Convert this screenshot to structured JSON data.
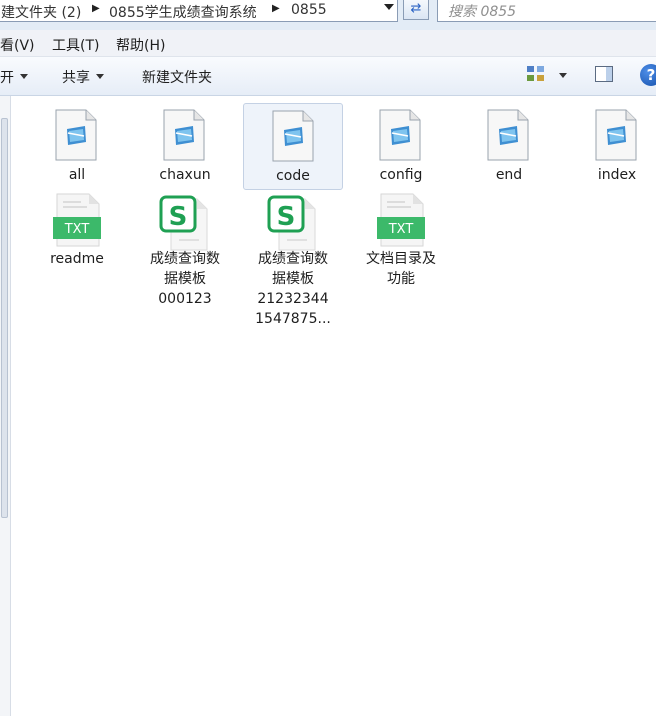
{
  "address_bar": {
    "breadcrumbs": [
      "建文件夹 (2)",
      "0855学生成绩查询系统",
      "0855"
    ],
    "search_placeholder": "搜索 0855"
  },
  "menu": {
    "items": [
      "看(V)",
      "工具(T)",
      "帮助(H)"
    ]
  },
  "toolbar": {
    "open_label": "开",
    "share_label": "共享",
    "new_folder_label": "新建文件夹"
  },
  "files": [
    {
      "name": "all",
      "icon": "notepad-document-icon"
    },
    {
      "name": "chaxun",
      "icon": "notepad-document-icon"
    },
    {
      "name": "code",
      "icon": "notepad-document-icon",
      "selected": true
    },
    {
      "name": "config",
      "icon": "notepad-document-icon"
    },
    {
      "name": "end",
      "icon": "notepad-document-icon"
    },
    {
      "name": "index",
      "icon": "notepad-document-icon"
    },
    {
      "name": "readme",
      "icon": "txt-file-icon",
      "badge": "TXT"
    },
    {
      "name_lines": [
        "成绩查询数",
        "据模板",
        "000123"
      ],
      "icon": "wps-spreadsheet-icon",
      "badge": "S"
    },
    {
      "name_lines": [
        "成绩查询数",
        "据模板",
        "21232344",
        "1547875..."
      ],
      "icon": "wps-spreadsheet-icon",
      "badge": "S"
    },
    {
      "name_lines": [
        "文档目录及",
        "功能"
      ],
      "icon": "txt-file-icon",
      "badge": "TXT"
    }
  ],
  "colors": {
    "txt_badge": "#3cb96a",
    "wps_green": "#1fa053",
    "selection_bg": "#eef3fa"
  }
}
